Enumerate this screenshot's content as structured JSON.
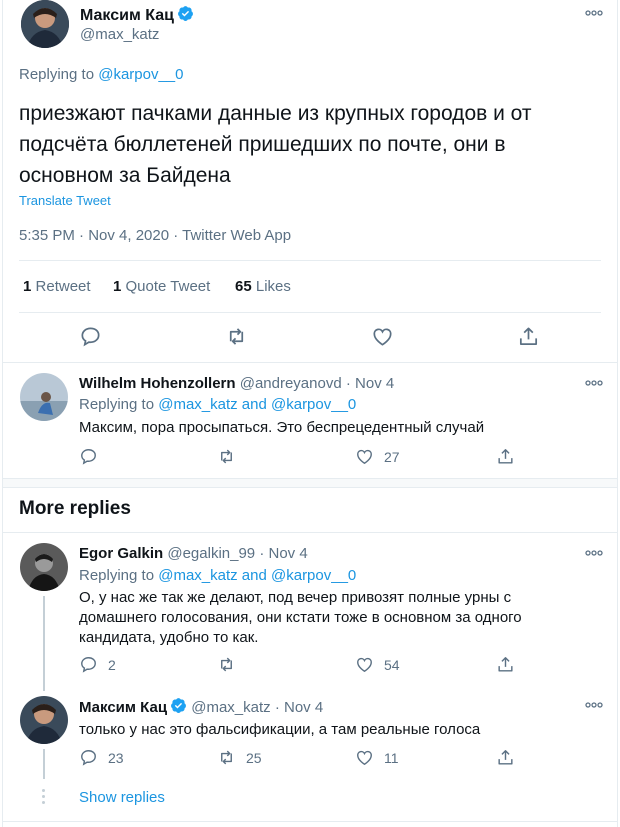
{
  "main_tweet": {
    "author_name": "Максим Кац",
    "author_handle": "@max_katz",
    "replying_label": "Replying to",
    "replying_to": "@karpov__0",
    "text": "приезжают пачками данные из крупных городов и от подсчёта бюллетеней пришедших по почте, они в основном за Байдена",
    "translate_label": "Translate Tweet",
    "timestamp": "5:35 PM · Nov 4, 2020 · Twitter Web App",
    "stats": {
      "retweets_count": "1",
      "retweets_label": "Retweet",
      "quotes_count": "1",
      "quotes_label": "Quote Tweet",
      "likes_count": "65",
      "likes_label": "Likes"
    }
  },
  "reply_1": {
    "author_name": "Wilhelm Hohenzollern",
    "author_handle": "@andreyanovd",
    "date": "· Nov 4",
    "replying_label": "Replying to",
    "replying_to": "@max_katz and @karpov__0",
    "text": "Максим, пора просыпаться. Это беспрецедентный случай",
    "reply_count": "",
    "retweet_count": "",
    "like_count": "27"
  },
  "more_replies": {
    "heading": "More replies"
  },
  "reply_2": {
    "author_name": "Egor Galkin",
    "author_handle": "@egalkin_99",
    "date": "· Nov 4",
    "replying_label": "Replying to",
    "replying_to": "@max_katz and @karpov__0",
    "text": "О, у нас же так же делают, под вечер привозят полные урны с домашнего голосования, они кстати тоже в основном за одного кандидата, удобно то как.",
    "reply_count": "2",
    "retweet_count": "",
    "like_count": "54"
  },
  "reply_3": {
    "author_name": "Максим Кац",
    "author_handle": "@max_katz",
    "date": "· Nov 4",
    "text": "только у нас это фальсификации, а там реальные голоса",
    "reply_count": "23",
    "retweet_count": "25",
    "like_count": "11"
  },
  "show_replies": {
    "label": "Show replies"
  },
  "colors": {
    "accent": "#1b95e0",
    "secondary_text": "#5b7083",
    "divider": "#e6ecf0",
    "verified": "#1da1f2"
  },
  "icons": [
    "reply-icon",
    "retweet-icon",
    "like-icon",
    "share-icon",
    "more-icon",
    "verified-icon"
  ]
}
